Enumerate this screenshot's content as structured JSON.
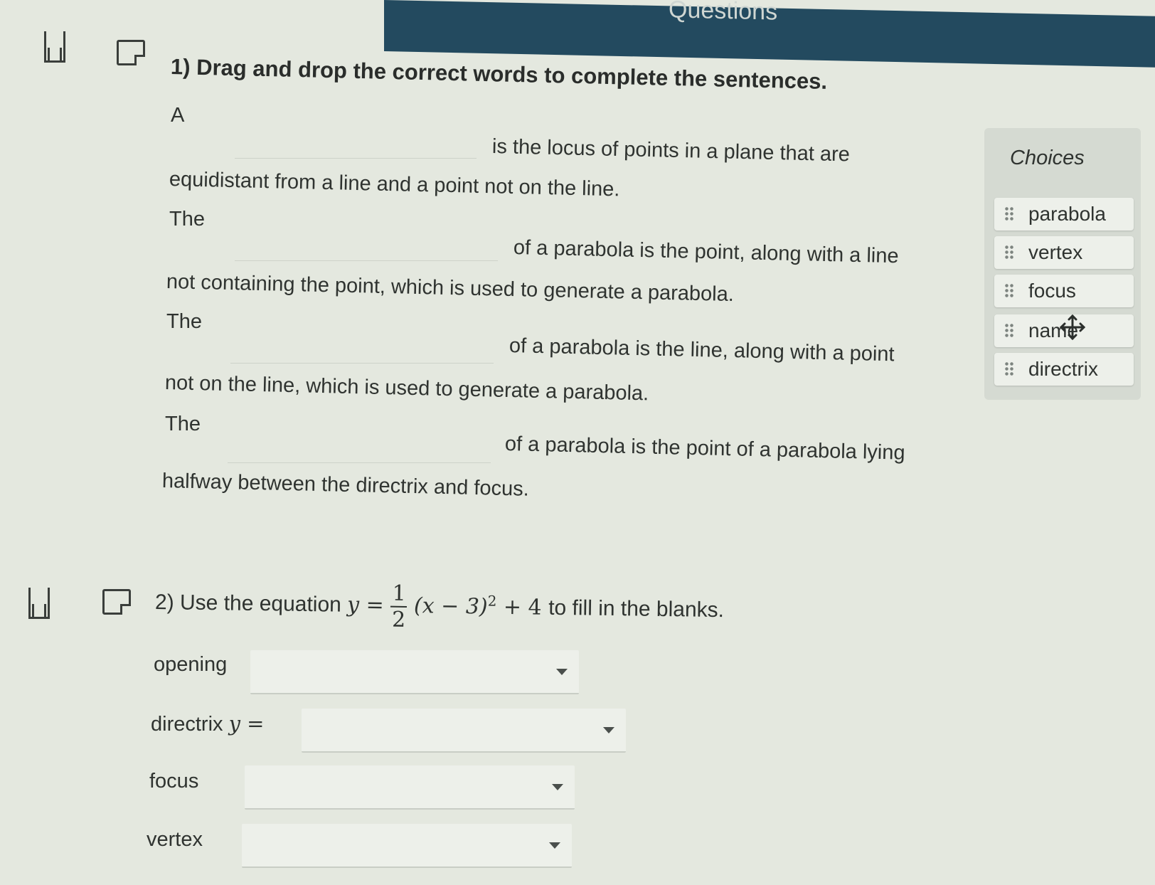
{
  "header": {
    "title": "Questions"
  },
  "question1": {
    "number_title": "1) Drag and drop the correct words to complete the sentences.",
    "sentences": [
      {
        "lead": "A",
        "rest_line1": "is the locus of points in a plane that are",
        "rest_line2": "equidistant from a line and a point not on the line."
      },
      {
        "lead": "The",
        "rest_line1": "of a parabola is the point, along with a line",
        "rest_line2": "not containing the point, which is used to generate a parabola."
      },
      {
        "lead": "The",
        "rest_line1": "of a parabola is the line, along with a point",
        "rest_line2": "not on the line, which is used to generate a parabola."
      },
      {
        "lead": "The",
        "rest_line1": "of a parabola is the point of a parabola lying",
        "rest_line2": "halfway between the directrix and focus."
      }
    ],
    "choices": {
      "title": "Choices",
      "items": [
        "parabola",
        "vertex",
        "focus",
        "name",
        "directrix"
      ]
    }
  },
  "question2": {
    "prefix": "2) Use the equation",
    "equation": {
      "lhs": "y",
      "eq": "=",
      "num": "1",
      "den": "2",
      "tail": "(x − 3)",
      "exp": "2",
      "plus": "+ 4"
    },
    "suffix": "to fill in the blanks.",
    "fields": [
      {
        "label": "opening",
        "value": ""
      },
      {
        "label": "directrix",
        "math": "y =",
        "value": ""
      },
      {
        "label": "focus",
        "value": ""
      },
      {
        "label": "vertex",
        "value": ""
      }
    ]
  }
}
